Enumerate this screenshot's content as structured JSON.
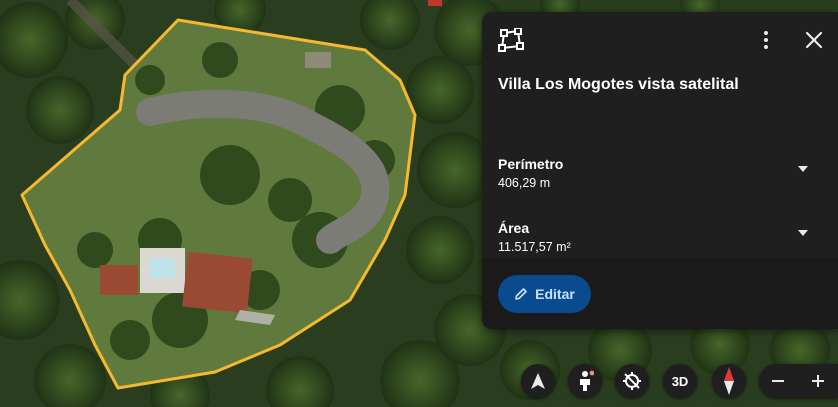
{
  "panel": {
    "title": "Villa Los Mogotes vista satelital",
    "perimeter_label": "Perímetro",
    "perimeter_value": "406,29 m",
    "area_label": "Área",
    "area_value": "11.517,57 m²",
    "edit_label": "Editar"
  },
  "controls": {
    "three_d_label": "3D"
  },
  "colors": {
    "polygon_stroke": "#f5b82e",
    "panel_bg": "#1f1f1f",
    "edit_bg": "#0a4b8f",
    "edit_text": "#c8e0ff",
    "compass_red": "#e53935"
  },
  "icons": [
    "polygon-shape-icon",
    "more-vert-icon",
    "close-icon",
    "chevron-down-icon",
    "pencil-icon",
    "navigation-arrow-icon",
    "pegman-icon",
    "tilt-reset-icon",
    "compass-icon",
    "zoom-out-icon",
    "zoom-in-icon"
  ]
}
